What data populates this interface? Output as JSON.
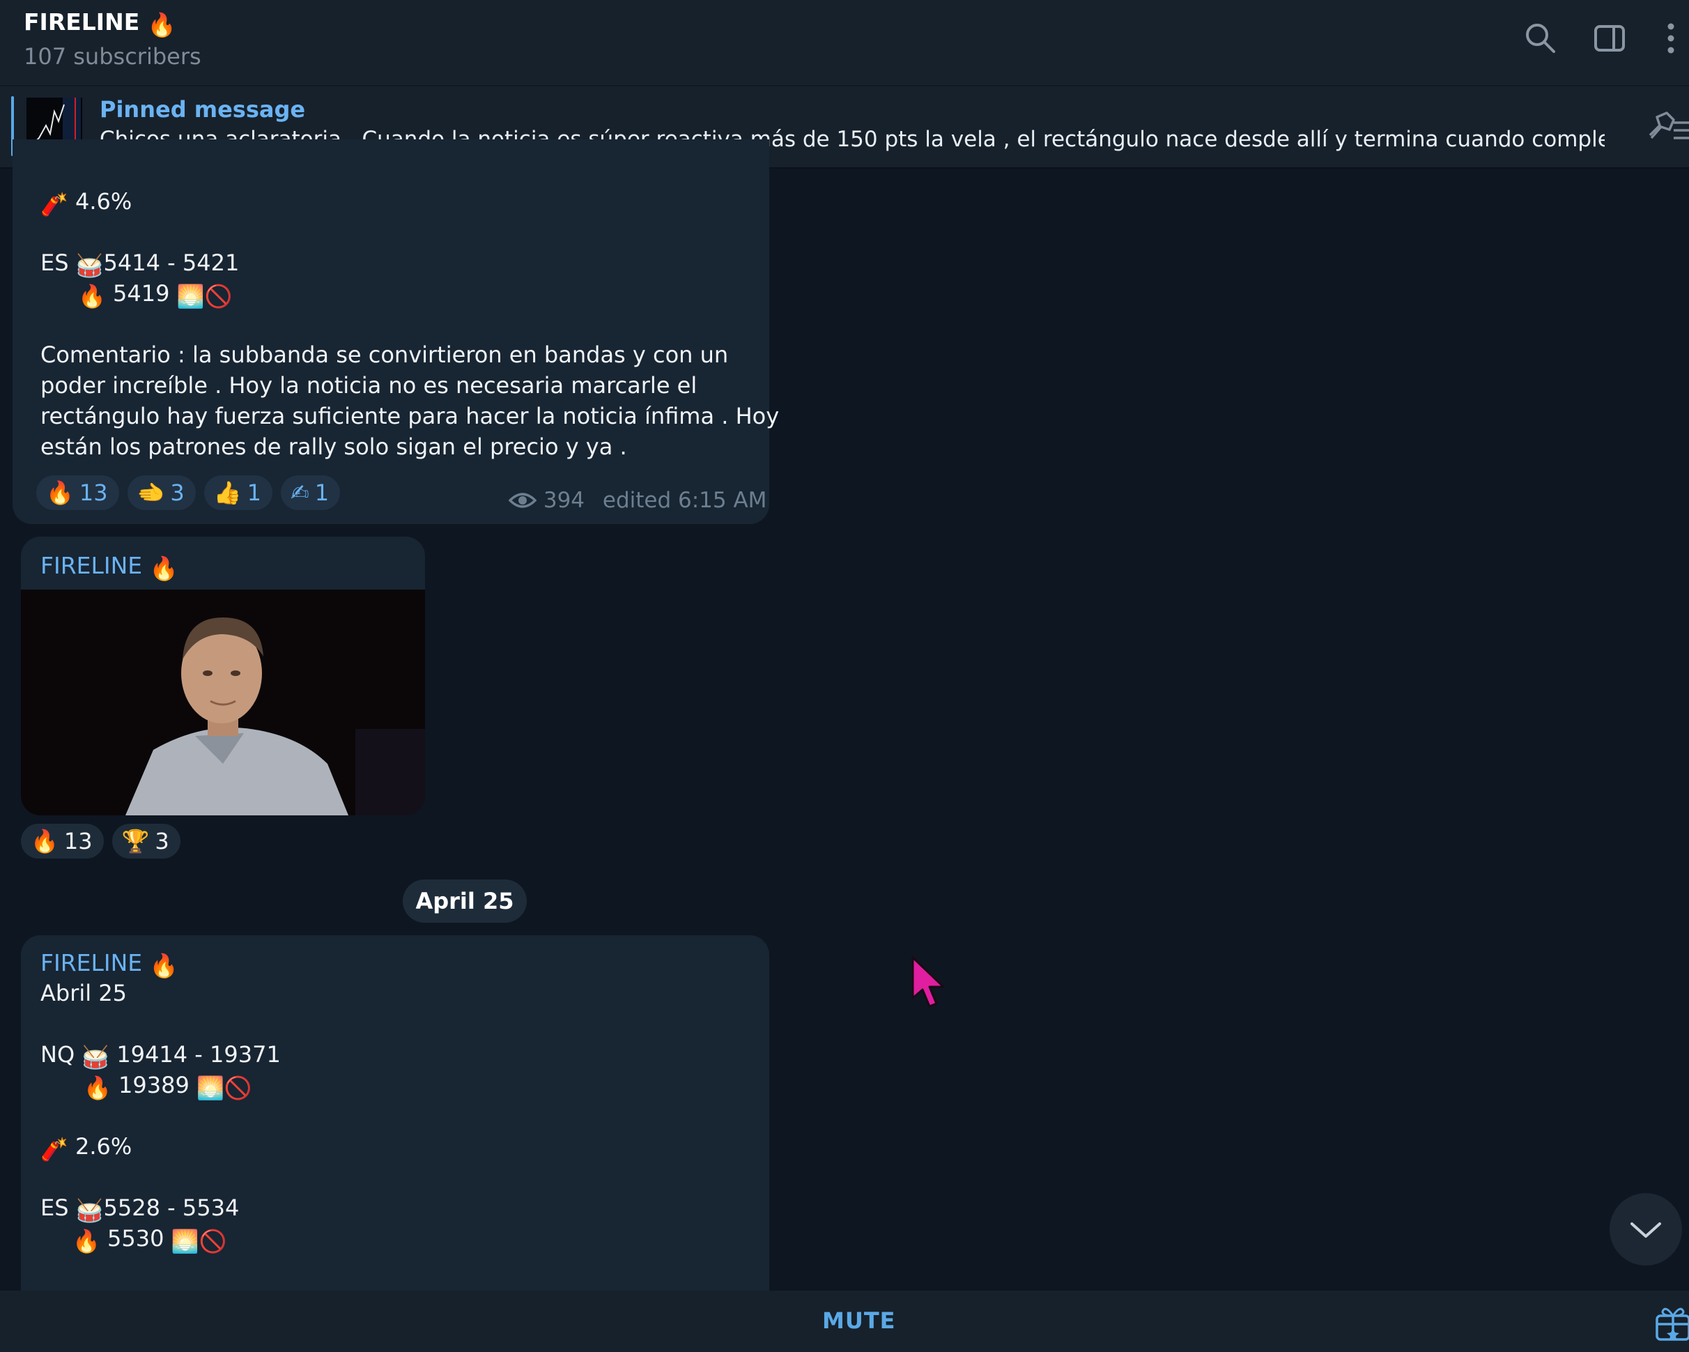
{
  "header": {
    "title": "FIRELINE",
    "subscribers": "107 subscribers"
  },
  "pinned": {
    "title": "Pinned message",
    "text": "Chicos una aclaratoria .  Cuando la noticia es súper reactiva más de 150 pts la vela , el rectángulo nace desde allí y termina cuando complete las..."
  },
  "msg1": {
    "pct": "4.6%",
    "es_prefix": "ES",
    "es_range": "5414 - 5421",
    "es_fire": "5419",
    "comment": [
      " Comentario : la subbanda se convirtieron en bandas y con un",
      "poder increíble . Hoy la noticia no es necesaria marcarle el",
      "rectángulo hay fuerza suficiente para hacer la noticia ínfima . Hoy",
      "están los patrones de rally solo sigan el precio y ya ."
    ],
    "reactions": [
      {
        "emoji": "🔥",
        "count": "13"
      },
      {
        "emoji": "🫲",
        "count": "3"
      },
      {
        "emoji": "👍",
        "count": "1"
      },
      {
        "emoji": "✍",
        "count": "1"
      }
    ],
    "views": "394",
    "edited": "edited 6:15 AM"
  },
  "msg2": {
    "name": "FIRELINE",
    "reactions": [
      {
        "emoji": "🔥",
        "count": "13"
      },
      {
        "emoji": "🏆",
        "count": "3"
      }
    ]
  },
  "date_separator": "April 25",
  "msg3": {
    "name": "FIRELINE",
    "date": "Abril 25",
    "nq_prefix": "NQ",
    "nq_range": "19414 - 19371",
    "nq_fire": "19389",
    "pct": "2.6%",
    "es_prefix": "ES",
    "es_range": "5528 - 5534",
    "es_fire": "5530"
  },
  "bottom": {
    "mute": "MUTE"
  },
  "colors": {
    "background": "#0e1621",
    "panel": "#17212b",
    "bubble": "#182533",
    "accent": "#6ab3f3",
    "muted": "#7f8b98"
  },
  "icons": [
    "search-icon",
    "sidebar-toggle-icon",
    "more-icon",
    "pin-list-icon",
    "eye-icon",
    "chevron-down-icon",
    "gift-icon",
    "cursor-icon"
  ]
}
